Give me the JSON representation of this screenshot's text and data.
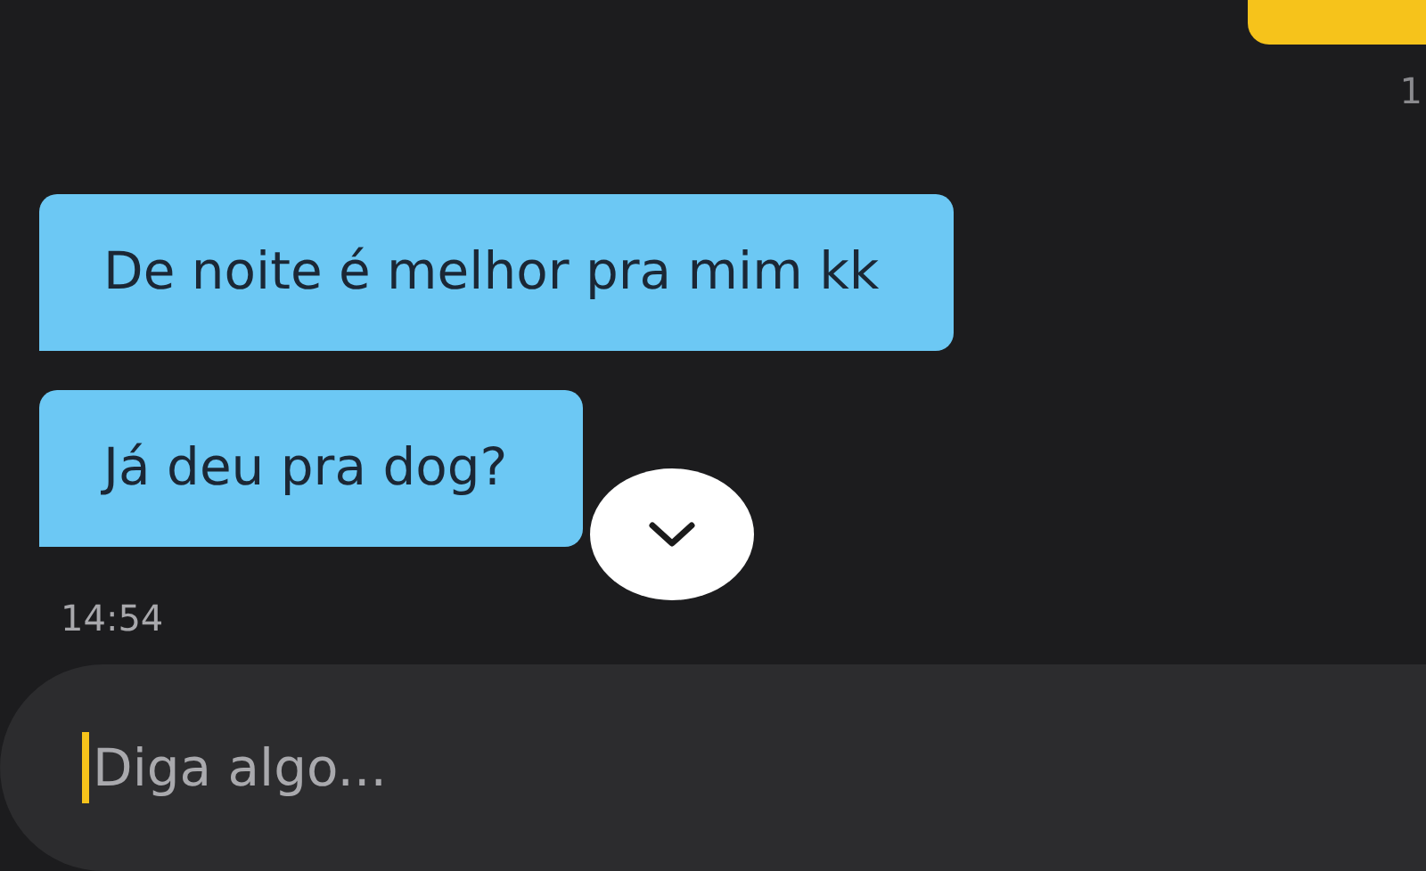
{
  "messages": [
    {
      "kind": "outgoing",
      "time": "1"
    },
    {
      "kind": "incoming",
      "text": "De noite é melhor pra mim kk"
    },
    {
      "kind": "incoming",
      "text": "Já deu pra dog?",
      "time": "14:54"
    }
  ],
  "composer": {
    "placeholder": "Diga algo..."
  }
}
